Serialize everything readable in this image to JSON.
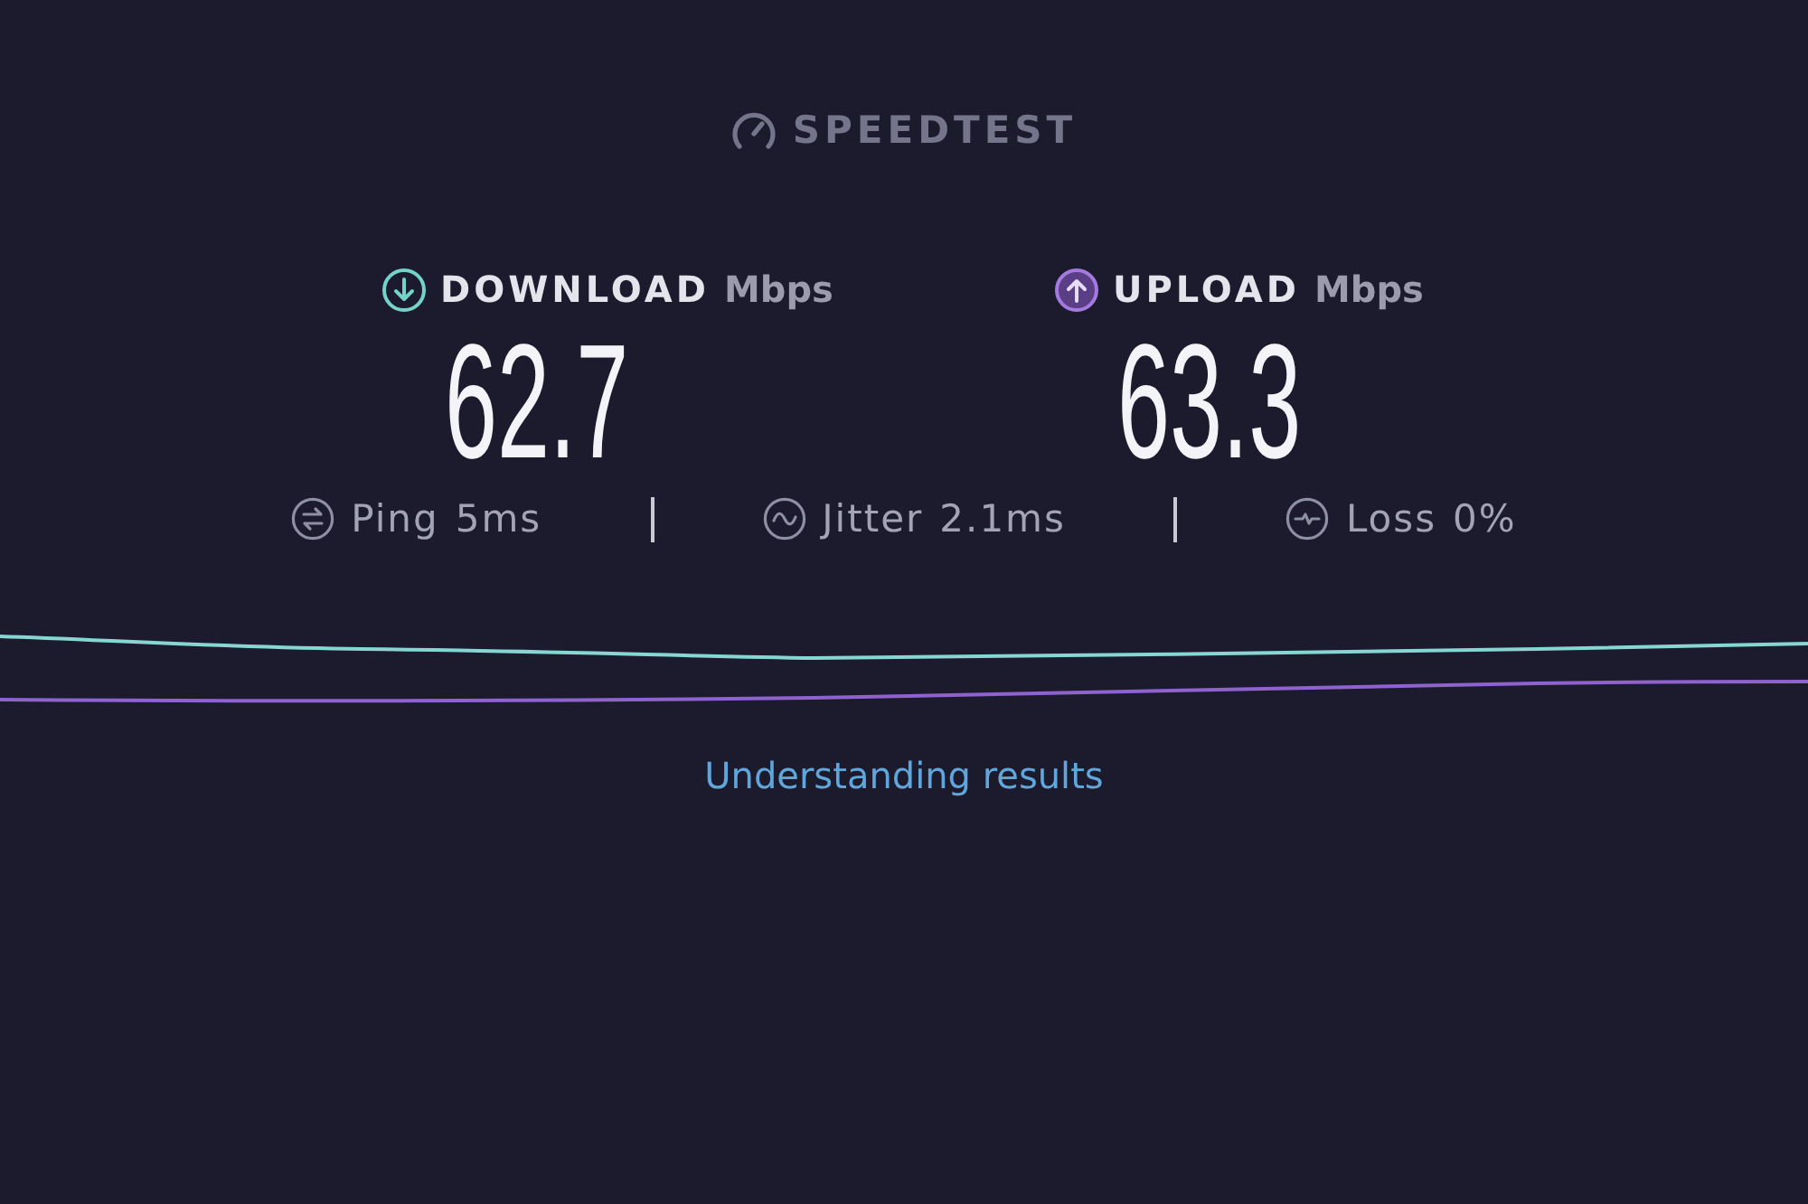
{
  "logo": {
    "text": "SPEEDTEST"
  },
  "results": [
    {
      "kind": "download",
      "label": "DOWNLOAD",
      "unit": "Mbps",
      "value": "62.7"
    },
    {
      "kind": "upload",
      "label": "UPLOAD",
      "unit": "Mbps",
      "value": "63.3"
    }
  ],
  "metrics": [
    {
      "kind": "ping",
      "label": "Ping",
      "value": "5ms"
    },
    {
      "kind": "jitter",
      "label": "Jitter",
      "value": "2.1ms"
    },
    {
      "kind": "loss",
      "label": "Loss",
      "value": "0%"
    }
  ],
  "link": "Understanding results"
}
